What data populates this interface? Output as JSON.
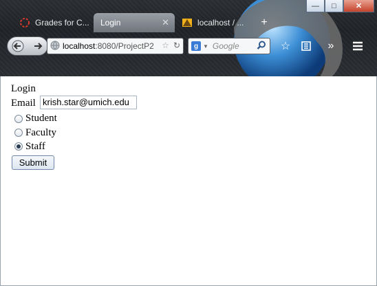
{
  "browser": {
    "tabs": [
      {
        "label": "Grades for C...",
        "icon": "loading-ring-icon"
      },
      {
        "label": "Login",
        "active": true
      },
      {
        "label": "localhost / ...",
        "icon": "phpmyadmin-icon"
      }
    ],
    "new_tab_label": "+",
    "url": {
      "host": "localhost",
      "rest": ":8080/ProjectP2"
    },
    "search": {
      "engine": "g",
      "placeholder": "Google"
    }
  },
  "page": {
    "heading": "Login",
    "email_label": "Email",
    "email_value": "krish.star@umich.edu",
    "roles": [
      {
        "label": "Student",
        "checked": false
      },
      {
        "label": "Faculty",
        "checked": false
      },
      {
        "label": "Staff",
        "checked": true
      }
    ],
    "submit_label": "Submit"
  },
  "colors": {
    "close_button": "#c4422b",
    "chrome_bg": "#1f2226"
  }
}
